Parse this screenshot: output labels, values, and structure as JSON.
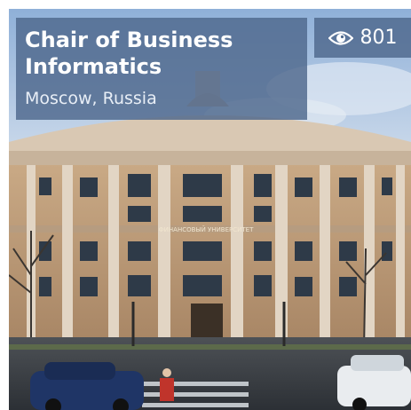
{
  "card": {
    "title": "Chair of Business Informatics",
    "location": "Moscow, Russia",
    "views": "801",
    "views_icon": "eye-icon",
    "building_sign": "ФИНАНСОВЫЙ УНИВЕРСИТЕТ"
  }
}
